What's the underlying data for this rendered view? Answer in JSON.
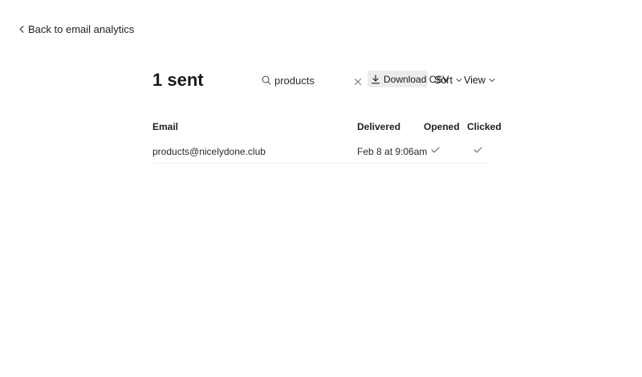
{
  "nav": {
    "back_label": "Back to email analytics"
  },
  "header": {
    "title": "1 sent"
  },
  "search": {
    "value": "products",
    "placeholder": ""
  },
  "toolbar": {
    "download_label": "Download CSV",
    "sort_label": "Sort",
    "view_label": "View"
  },
  "table": {
    "columns": [
      "Email",
      "Delivered",
      "Opened",
      "Clicked"
    ],
    "rows": [
      {
        "email": "products@nicelydone.club",
        "delivered": "Feb 8 at 9:06am",
        "opened": true,
        "clicked": true
      }
    ]
  },
  "icons": {
    "back": "chevron-left-icon",
    "search": "search-icon",
    "clear": "close-icon",
    "download": "download-icon",
    "dropdown": "chevron-down-icon",
    "check": "check-icon"
  },
  "colors": {
    "text": "#1f1f1f",
    "button_bg": "#ececec",
    "icon": "#6b6b6b"
  }
}
